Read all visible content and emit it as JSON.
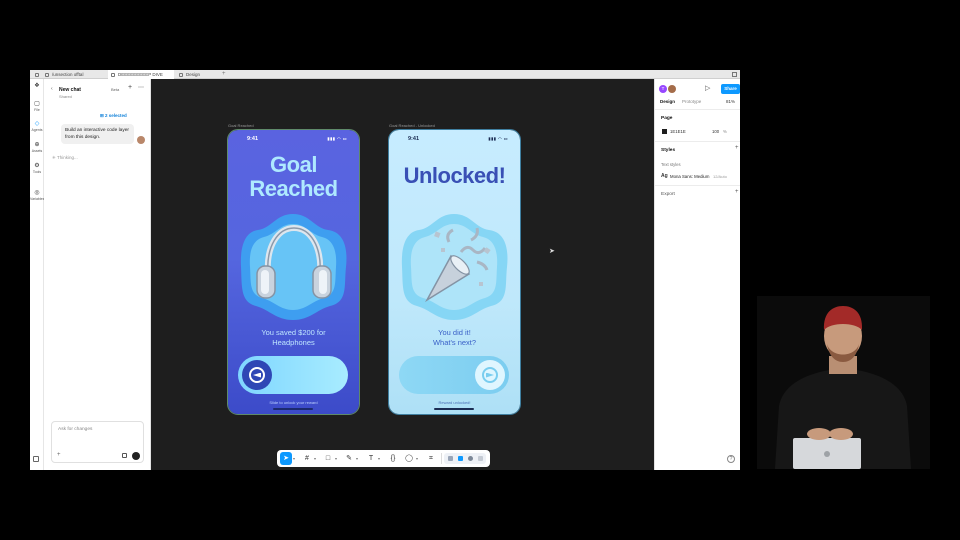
{
  "tabs": [
    {
      "label": "/unsection offtal"
    },
    {
      "label": "DEEEEEEEEEP DIVE"
    },
    {
      "label": "Design"
    }
  ],
  "rail": {
    "items": [
      {
        "label": "File",
        "icon": "file-icon"
      },
      {
        "label": "Agents",
        "icon": "agents-icon"
      },
      {
        "label": "Assets",
        "icon": "assets-icon"
      },
      {
        "label": "Tools",
        "icon": "tools-icon"
      },
      {
        "label": "Variables",
        "icon": "variables-icon"
      }
    ]
  },
  "chat": {
    "title": "New chat",
    "subtitle": "Shared",
    "beta": "Beta",
    "selected_chip": "2 selected",
    "user_message": "Build an interactive code layer from this design.",
    "thinking": "Thinking...",
    "input_placeholder": "Ask for changes"
  },
  "canvas": {
    "bg_color": "#1e1e1e",
    "frames": [
      {
        "label": "Goal Reached",
        "status_time": "9:41",
        "title_line1": "Goal",
        "title_line2": "Reached",
        "caption_line1": "You saved $200 for",
        "caption_line2": "Headphones",
        "hint": "Slide to unlock your reward",
        "illustration": "headphones-illustration"
      },
      {
        "label": "Goal Reached - Unlocked",
        "status_time": "9:41",
        "title": "Unlocked!",
        "caption_line1": "You did it!",
        "caption_line2": "What's next?",
        "hint": "Reward unlocked!",
        "illustration": "party-popper-illustration"
      }
    ]
  },
  "toolbar": {
    "tools": [
      "move-tool-icon",
      "frame-tool-icon",
      "shape-tool-icon",
      "pen-tool-icon",
      "text-tool-icon",
      "code-tool-icon",
      "comment-tool-icon",
      "actions-tool-icon"
    ],
    "accent": "#0d99ff"
  },
  "right_panel": {
    "avatar_initial": "T",
    "share_label": "Share",
    "tab_design": "Design",
    "tab_prototype": "Prototype",
    "zoom": "81%",
    "page_heading": "Page",
    "page_color": "1E1E1E",
    "page_opacity": "100",
    "page_pct": "%",
    "styles_heading": "Styles",
    "text_styles_label": "Text styles",
    "style_glyph": "Ag",
    "style_name": "Mona Sans: Medium",
    "style_size": "12/Auto",
    "export_heading": "Export",
    "help": "?"
  }
}
